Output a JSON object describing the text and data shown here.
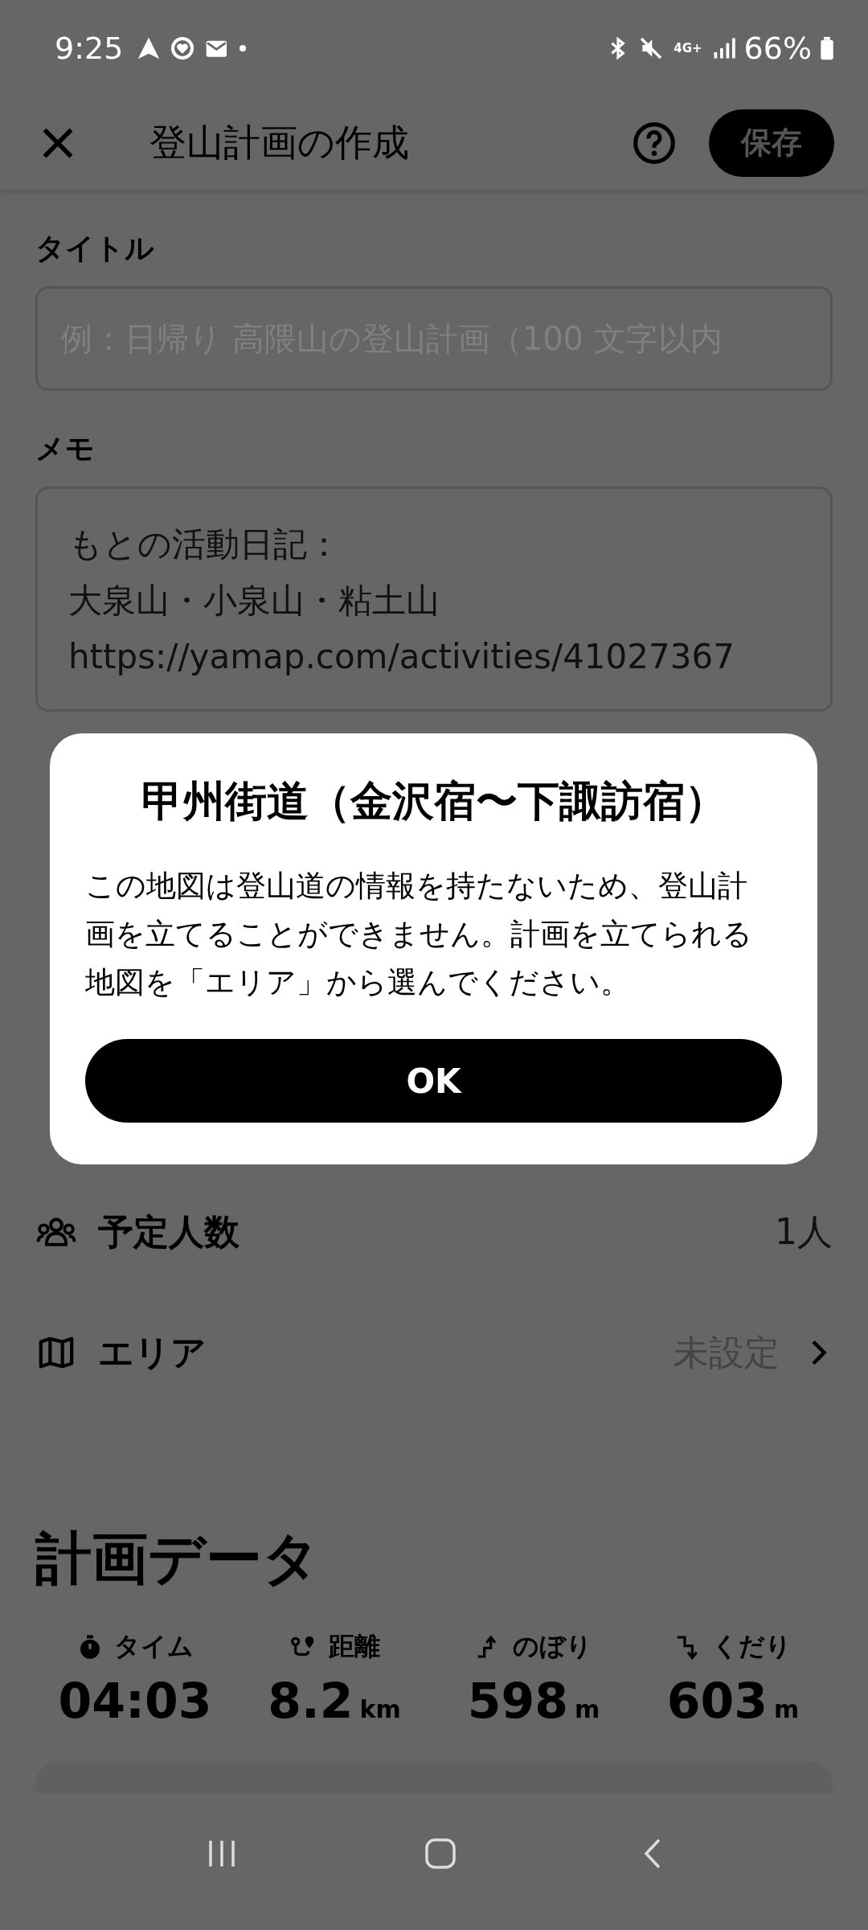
{
  "status_bar": {
    "time": "9:25",
    "network": "4G+",
    "battery": "66%"
  },
  "header": {
    "title": "登山計画の作成",
    "save_button": "保存"
  },
  "form": {
    "title_label": "タイトル",
    "title_placeholder": "例：日帰り 高隈山の登山計画（100 文字以内",
    "memo_label": "メモ",
    "memo_lines": [
      "もとの活動日記：",
      "大泉山・小泉山・粘土山",
      "https://yamap.com/activities/41027367"
    ]
  },
  "rows": [
    {
      "kind": "people",
      "label": "予定人数",
      "value": "1人"
    },
    {
      "kind": "area",
      "label": "エリア",
      "value": "未設定"
    }
  ],
  "plan_data": {
    "heading": "計画データ",
    "stats": [
      {
        "kind": "time",
        "label": "タイム",
        "value": "04:03"
      },
      {
        "kind": "distance",
        "label": "距離",
        "value": "8.2",
        "unit": "km"
      },
      {
        "kind": "ascent",
        "label": "のぼり",
        "value": "598",
        "unit": "m"
      },
      {
        "kind": "descent",
        "label": "くだり",
        "value": "603",
        "unit": "m"
      }
    ]
  },
  "dialog": {
    "title": "甲州街道（金沢宿〜下諏訪宿）",
    "message": "この地図は登山道の情報を持たないため、登山計画を立てることができません。計画を立てられる地図を「エリア」から選んでください。",
    "ok_button": "OK"
  }
}
